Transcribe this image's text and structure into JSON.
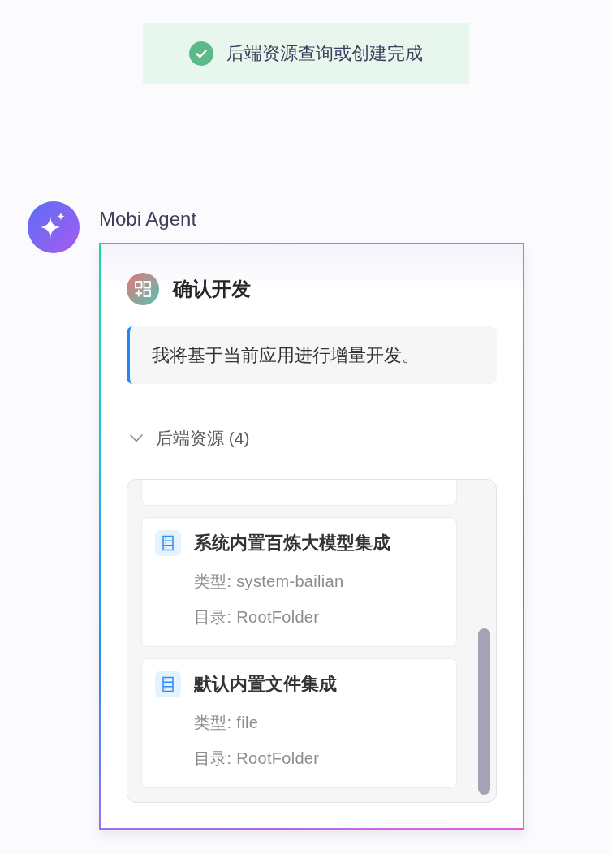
{
  "toast": {
    "kind": "success",
    "text": "后端资源查询或创建完成"
  },
  "agent": {
    "name": "Mobi Agent"
  },
  "card": {
    "title": "确认开发",
    "note": "我将基于当前应用进行增量开发。",
    "resources": {
      "label": "后端资源 (4)",
      "expanded": true,
      "items": [
        {
          "title": "系统内置百炼大模型集成",
          "lines": [
            "类型: system-bailian",
            "目录: RootFolder"
          ]
        },
        {
          "title": "默认内置文件集成",
          "lines": [
            "类型: file",
            "目录: RootFolder"
          ]
        }
      ]
    }
  }
}
